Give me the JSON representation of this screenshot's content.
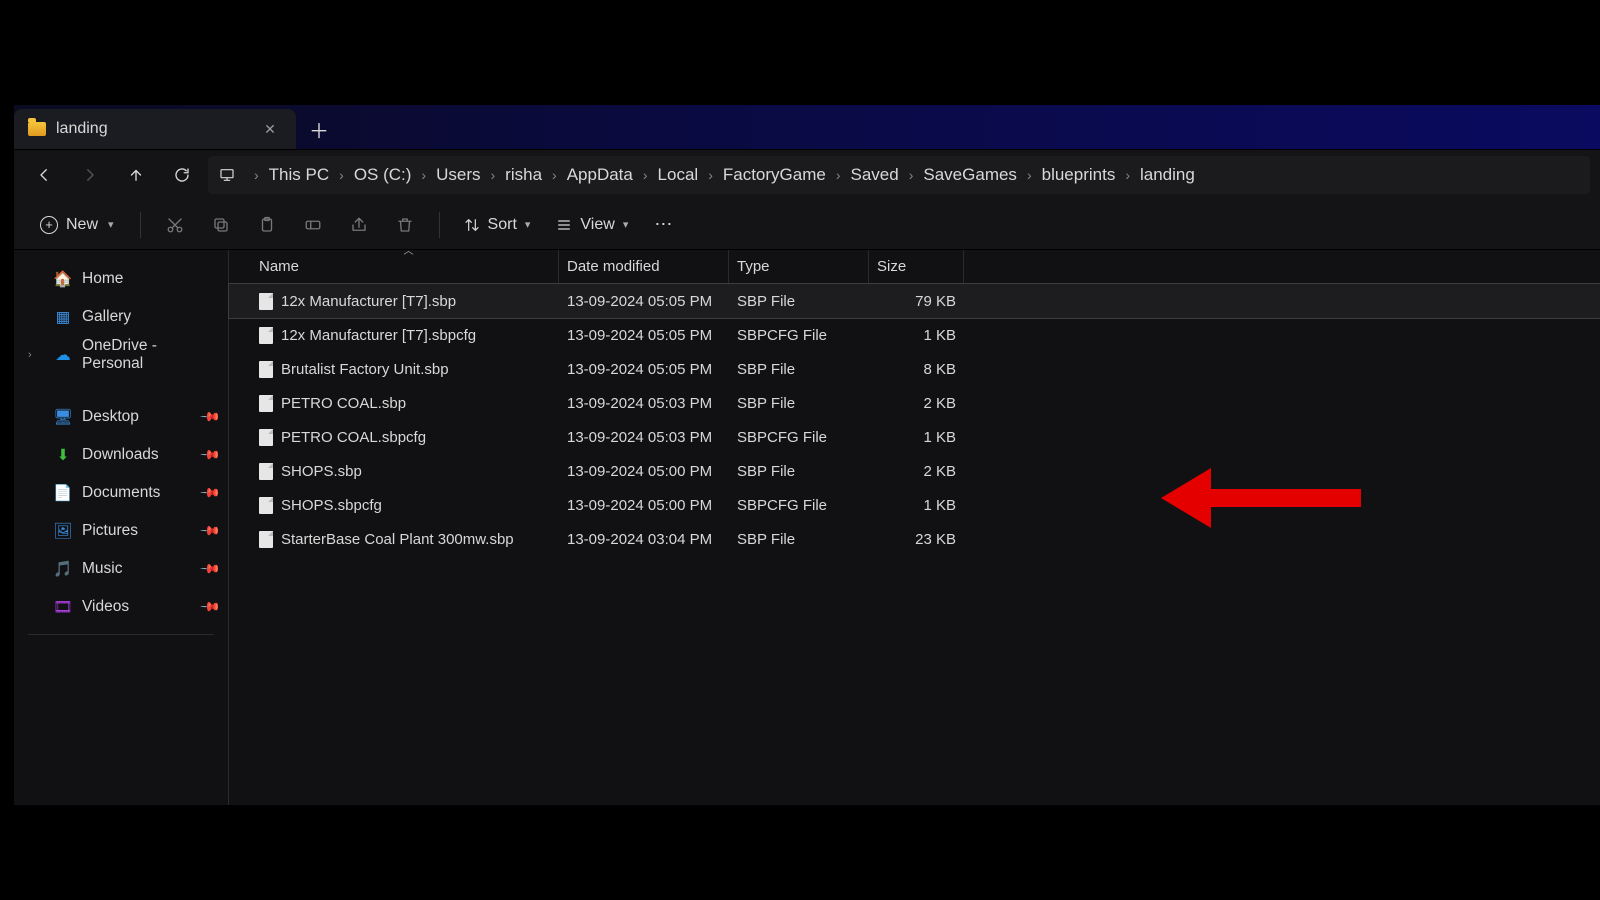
{
  "tab": {
    "title": "landing"
  },
  "breadcrumb": [
    "This PC",
    "OS (C:)",
    "Users",
    "risha",
    "AppData",
    "Local",
    "FactoryGame",
    "Saved",
    "SaveGames",
    "blueprints",
    "landing"
  ],
  "toolbar": {
    "new_label": "New",
    "sort_label": "Sort",
    "view_label": "View"
  },
  "sidebar": {
    "home": "Home",
    "gallery": "Gallery",
    "onedrive": "OneDrive - Personal",
    "desktop": "Desktop",
    "downloads": "Downloads",
    "documents": "Documents",
    "pictures": "Pictures",
    "music": "Music",
    "videos": "Videos"
  },
  "columns": {
    "name": "Name",
    "date": "Date modified",
    "type": "Type",
    "size": "Size"
  },
  "files": [
    {
      "name": "12x Manufacturer [T7].sbp",
      "date": "13-09-2024 05:05 PM",
      "type": "SBP File",
      "size": "79 KB",
      "selected": true
    },
    {
      "name": "12x Manufacturer [T7].sbpcfg",
      "date": "13-09-2024 05:05 PM",
      "type": "SBPCFG File",
      "size": "1 KB"
    },
    {
      "name": "Brutalist Factory Unit.sbp",
      "date": "13-09-2024 05:05 PM",
      "type": "SBP File",
      "size": "8 KB"
    },
    {
      "name": "PETRO COAL.sbp",
      "date": "13-09-2024 05:03 PM",
      "type": "SBP File",
      "size": "2 KB"
    },
    {
      "name": "PETRO COAL.sbpcfg",
      "date": "13-09-2024 05:03 PM",
      "type": "SBPCFG File",
      "size": "1 KB"
    },
    {
      "name": "SHOPS.sbp",
      "date": "13-09-2024 05:00 PM",
      "type": "SBP File",
      "size": "2 KB"
    },
    {
      "name": "SHOPS.sbpcfg",
      "date": "13-09-2024 05:00 PM",
      "type": "SBPCFG File",
      "size": "1 KB"
    },
    {
      "name": "StarterBase Coal Plant 300mw.sbp",
      "date": "13-09-2024 03:04 PM",
      "type": "SBP File",
      "size": "23 KB"
    }
  ],
  "annotation": {
    "target_row_index": 2,
    "color": "#e50000"
  }
}
